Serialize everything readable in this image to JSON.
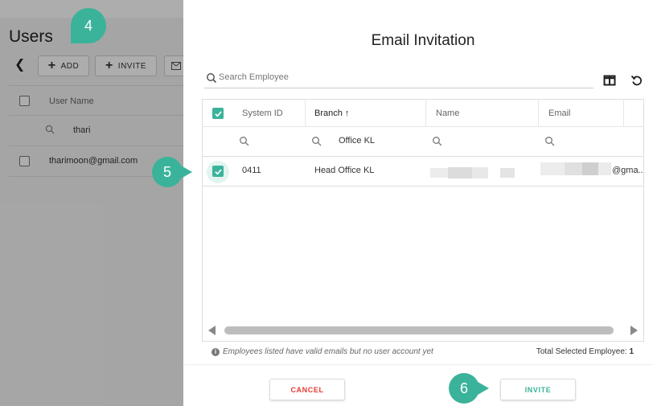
{
  "background": {
    "title": "Users",
    "add_label": "ADD",
    "invite_label": "INVITE",
    "column_user_name": "User Name",
    "filter_value": "thari",
    "row_email": "tharimoon@gmail.com"
  },
  "modal": {
    "title": "Email Invitation",
    "search_placeholder": "Search Employee",
    "grid": {
      "columns": [
        "System ID",
        "Branch ↑",
        "Name",
        "Email"
      ],
      "filter_branch": "Office KL",
      "row": {
        "system_id": "0411",
        "branch": "Head Office KL",
        "email_suffix": "@gma..."
      }
    },
    "footnote": "Employees listed have valid emails but no user account yet",
    "total_label": "Total Selected Employee:",
    "total_value": "1",
    "cancel_label": "CANCEL",
    "invite_label": "INVITE"
  },
  "markers": {
    "step4": "4",
    "step5": "5",
    "step6": "6"
  },
  "colors": {
    "accent": "#3bb39a",
    "cancel": "#e53935"
  }
}
